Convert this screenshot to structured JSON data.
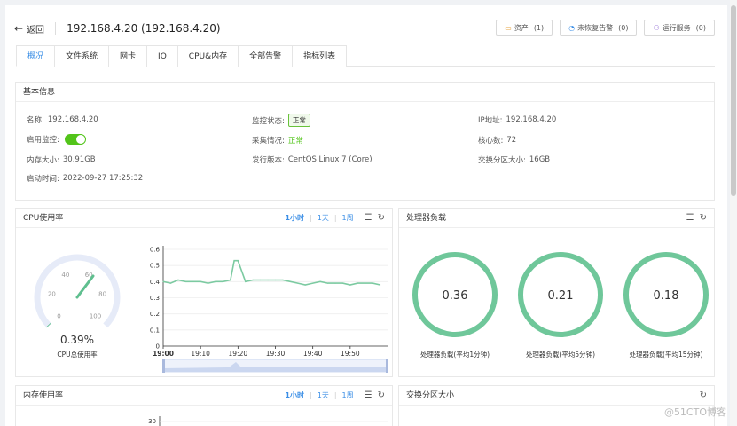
{
  "header": {
    "back_label": "返回",
    "title": "192.168.4.20 (192.168.4.20)",
    "buttons": [
      {
        "icon": "folder-icon",
        "label": "资产",
        "count": "(1)"
      },
      {
        "icon": "bell-icon",
        "label": "未恢复告警",
        "count": "(0)"
      },
      {
        "icon": "user-service-icon",
        "label": "运行服务",
        "count": "(0)"
      }
    ]
  },
  "tabs": [
    "概况",
    "文件系统",
    "网卡",
    "IO",
    "CPU&内存",
    "全部告警",
    "指标列表"
  ],
  "active_tab": "概况",
  "basic": {
    "title": "基本信息",
    "name_k": "名称:",
    "name_v": "192.168.4.20",
    "monitor_status_k": "监控状态:",
    "monitor_status_v": "正常",
    "ip_k": "IP地址:",
    "ip_v": "192.168.4.20",
    "enable_k": "启用监控:",
    "collect_k": "采集情况:",
    "collect_v": "正常",
    "cores_k": "核心数:",
    "cores_v": "72",
    "mem_k": "内存大小:",
    "mem_v": "30.91GB",
    "os_k": "发行版本:",
    "os_v": "CentOS Linux 7 (Core)",
    "swap_k": "交换分区大小:",
    "swap_v": "16GB",
    "boot_k": "启动时间:",
    "boot_v": "2022-09-27 17:25:32"
  },
  "range_links": {
    "h1": "1小时",
    "d1": "1天",
    "w1": "1周",
    "sep": "|"
  },
  "cpu": {
    "title": "CPU使用率",
    "gauge_value": "0.39%",
    "gauge_label": "CPU总使用率",
    "gauge_ticks": [
      "0",
      "20",
      "40",
      "60",
      "80",
      "100"
    ],
    "gauge_fraction": 0.0039
  },
  "load": {
    "title": "处理器负载",
    "rings": [
      {
        "value": "0.36",
        "label": "处理器负载(平均1分钟)"
      },
      {
        "value": "0.21",
        "label": "处理器负载(平均5分钟)"
      },
      {
        "value": "0.18",
        "label": "处理器负载(平均15分钟)"
      }
    ]
  },
  "mem": {
    "title": "内存使用率",
    "ytick_top": "30"
  },
  "swap": {
    "title": "交换分区大小"
  },
  "watermark": "@51CTO博客",
  "chart_data": {
    "type": "line",
    "title": "",
    "xlabel": "",
    "ylabel": "",
    "x": [
      "19:00",
      "19:02",
      "19:04",
      "19:06",
      "19:08",
      "19:10",
      "19:12",
      "19:14",
      "19:16",
      "19:18",
      "19:19",
      "19:20",
      "19:22",
      "19:24",
      "19:26",
      "19:28",
      "19:30",
      "19:32",
      "19:34",
      "19:36",
      "19:38",
      "19:40",
      "19:42",
      "19:44",
      "19:46",
      "19:48",
      "19:50",
      "19:52",
      "19:54",
      "19:56",
      "19:58"
    ],
    "values": [
      0.4,
      0.39,
      0.41,
      0.4,
      0.4,
      0.4,
      0.39,
      0.4,
      0.4,
      0.41,
      0.53,
      0.53,
      0.4,
      0.41,
      0.41,
      0.41,
      0.41,
      0.41,
      0.4,
      0.39,
      0.38,
      0.39,
      0.4,
      0.39,
      0.39,
      0.39,
      0.38,
      0.39,
      0.39,
      0.39,
      0.38
    ],
    "xticks": [
      "19:00",
      "19:10",
      "19:20",
      "19:30",
      "19:40",
      "19:50"
    ],
    "yticks": [
      "0",
      "0.1",
      "0.2",
      "0.3",
      "0.4",
      "0.5",
      "0.6"
    ],
    "ylim": [
      0,
      0.6
    ],
    "color": "#7ccaa1",
    "grid": true
  },
  "colors": {
    "accent": "#3a8ee6",
    "ok": "#52c41a",
    "ring": "#6fc79a",
    "gauge": "#5fbf8f"
  }
}
